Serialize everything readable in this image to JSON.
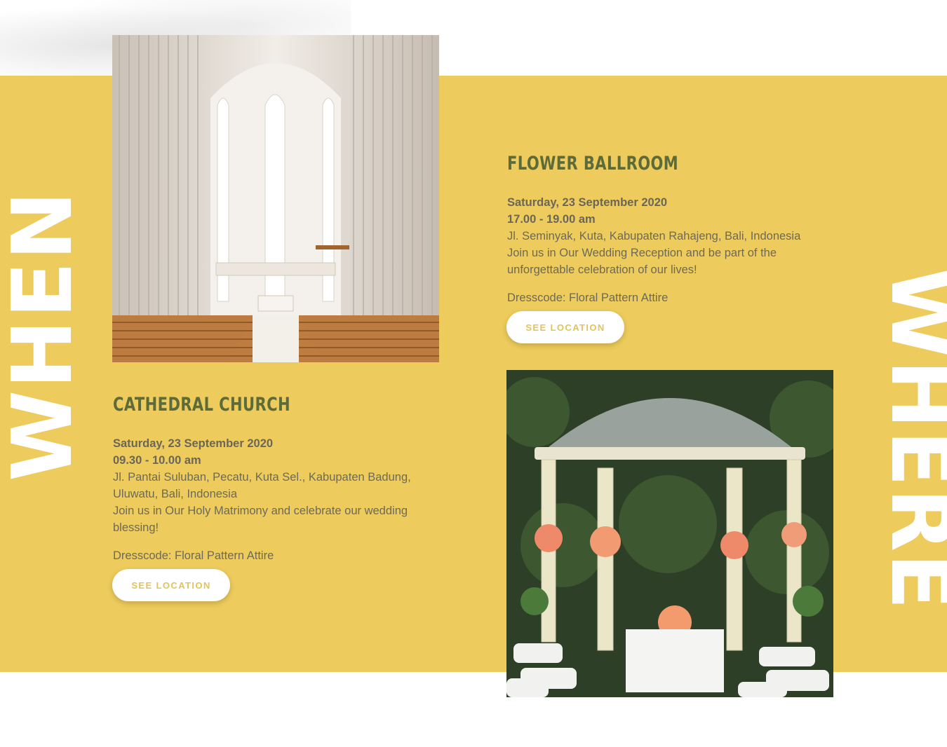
{
  "headings": {
    "when": "WHEN",
    "where": "WHERE"
  },
  "ceremony": {
    "title": "CATHEDRAL CHURCH",
    "date": "Saturday, 23 September 2020",
    "time": "09.30 - 10.00 am",
    "address": "Jl. Pantai Suluban, Pecatu, Kuta Sel., Kabupaten Badung, Uluwatu, Bali, Indonesia",
    "description": "Join us in Our Holy Matrimony and celebrate our wedding blessing!",
    "dresscode": "Dresscode: Floral Pattern Attire",
    "button_label": "SEE LOCATION"
  },
  "reception": {
    "title": "FLOWER BALLROOM",
    "date": "Saturday, 23 September 2020",
    "time": "17.00 - 19.00 am",
    "address": "Jl. Seminyak, Kuta, Kabupaten Rahajeng, Bali, Indonesia",
    "description": "Join us in Our Wedding Reception and be part of the unforgettable celebration of our lives!",
    "dresscode": "Dresscode: Floral Pattern Attire",
    "button_label": "SEE LOCATION"
  },
  "colors": {
    "band": "#edcb5c",
    "title": "#5d6b3a",
    "body_text": "#6c6a5a",
    "button_text": "#e4c35a"
  }
}
